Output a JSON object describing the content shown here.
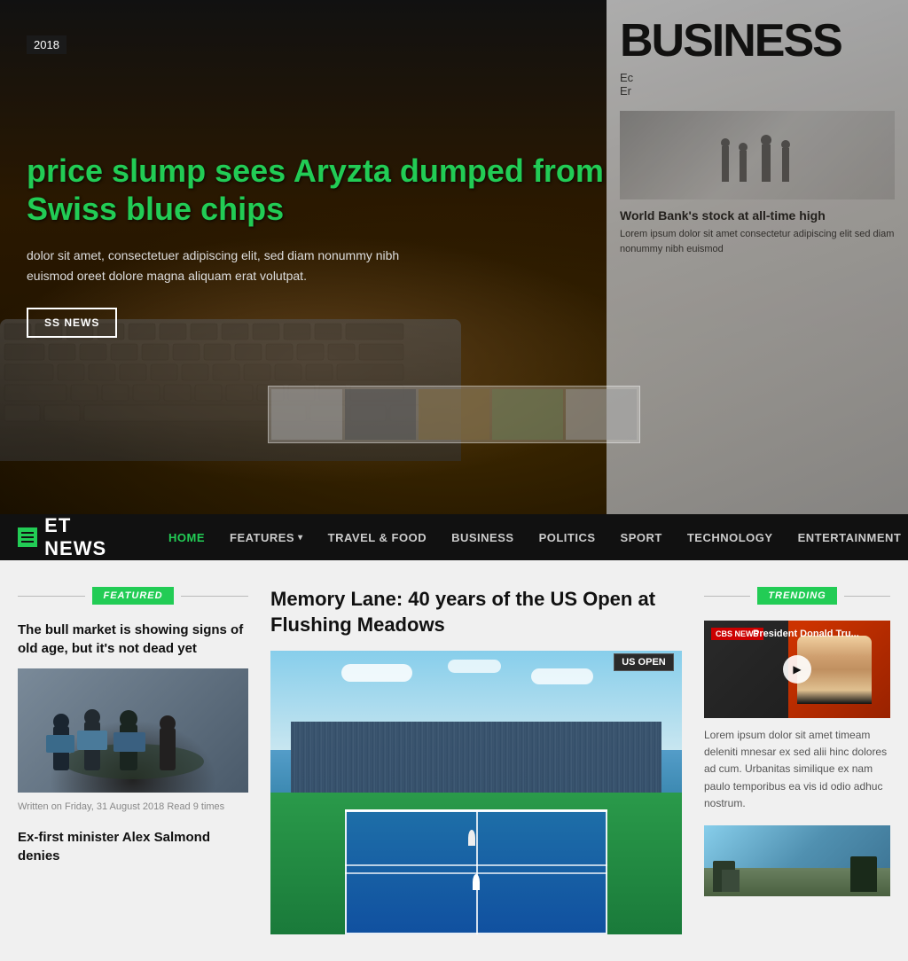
{
  "hero": {
    "year": "2018",
    "headline": "price slump sees Aryzta dumped from Swiss blue chips",
    "description": "dolor sit amet, consectetuer adipiscing elit, sed diam nonummy nibh euismod oreet dolore magna aliquam erat volutpat.",
    "button_label": "SS NEWS",
    "newspaper_title": "BUSINESS",
    "newspaper_sub1": "Ec",
    "newspaper_sub2": "Er",
    "newspaper_note": "World Bank's stock at all-time high"
  },
  "navbar": {
    "logo_text": "ET NEWS",
    "items": [
      {
        "label": "HOME",
        "active": true
      },
      {
        "label": "FEATURES",
        "arrow": true
      },
      {
        "label": "TRAVEL & FOOD"
      },
      {
        "label": "BUSINESS"
      },
      {
        "label": "POLITICS"
      },
      {
        "label": "SPORT"
      },
      {
        "label": "TECHNOLOGY"
      },
      {
        "label": "ENTERTAINMENT"
      }
    ]
  },
  "featured": {
    "section_label": "FEATURED",
    "article1_title": "The bull market is showing signs of old age, but it's not dead yet",
    "article1_meta": "Written on Friday, 31 August 2018  Read 9 times",
    "article2_title": "Ex-first minister Alex Salmond denies"
  },
  "center": {
    "article_title": "Memory Lane: 40 years of the US Open at Flushing Meadows"
  },
  "trending": {
    "section_label": "TRENDING",
    "video_badge": "CBS NEWS",
    "video_title": "President Donald Tru...",
    "video_description": "Lorem ipsum dolor sit amet timeam deleniti mnesar ex sed alii hinc dolores ad cum. Urbanitas similique ex nam paulo temporibus ea vis id odio adhuc nostrum."
  }
}
